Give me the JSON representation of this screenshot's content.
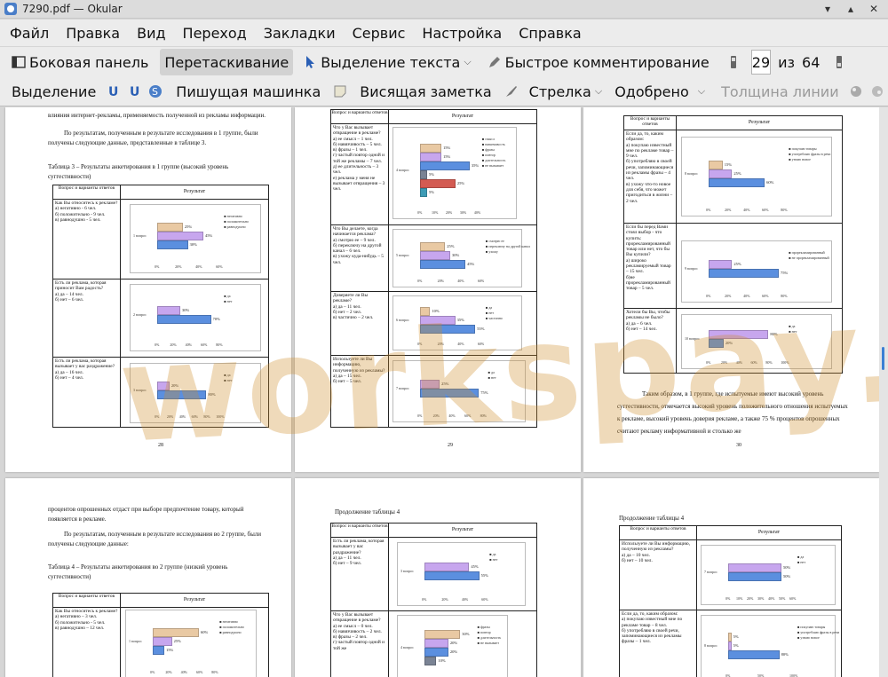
{
  "window": {
    "title": "7290.pdf — Okular"
  },
  "menu": [
    "Файл",
    "Правка",
    "Вид",
    "Переход",
    "Закладки",
    "Сервис",
    "Настройка",
    "Справка"
  ],
  "toolbar": {
    "sidebar": "Боковая панель",
    "drag": "Перетаскивание",
    "text_select": "Выделение текста",
    "quick_comment": "Быстрое комментирование",
    "page_current": "29",
    "page_of": "из",
    "page_total": "64"
  },
  "annot_toolbar": {
    "highlight": "Выделение",
    "typewriter": "Пишущая машинка",
    "note": "Висящая заметка",
    "arrow": "Стрелка",
    "stamp": "Одобрено",
    "line_width": "Толщина линии"
  },
  "watermark": "workspay.ru",
  "pages": {
    "p28": {
      "intro1": "влияния интернет-рекламы, применяемость полученной из рекламы информации.",
      "intro2": "По результатам, полученным в результате исследования в 1 группе, были получены следующие данные, представленные в таблице 3.",
      "caption": "Таблица 3 – Результаты анкетирования в 1 группе (высокий уровень суггестивности)",
      "col1": "Вопрос и варианты ответов",
      "col2": "Результат",
      "q1": "Как Вы относитесь к рекламе?\nа) негативно - 6 чел.\nб) положительно - 9 чел.\nв) равнодушно - 5 чел.",
      "q2": "Есть ли реклама, которая приносит Вам радость?\nа) да – 14 чел.\nб) нет – 6 чел.",
      "q3": "Есть ли реклама, которая вызывает у вас раздражение?\nа) да – 16 чел.\nб) нет – 4 чел.",
      "page_no": "28"
    },
    "p29": {
      "col1": "Вопрос и варианты ответов",
      "col2": "Результат",
      "q4": "Что у Вас вызывает отвращение в рекламе?\nа) ее смысл – 1 чел.\nб) навязчивость – 5 чел.\nв) фразы – 1 чел.\nг) частый повтор одной и той же рекламы – 7 чел.\nд) ее длительность – 3 чел.\nе) реклама у меня не вызывает отвращения – 3 чел.",
      "q5": "Что Вы делаете, когда начинается реклама?\nа) смотрю ее – 9 чел.\nб) переключу на другой канал – 6 чел.\nв) ухожу куда-нибудь – 5 чел.",
      "q6": "Доверяете ли Вы рекламе?\nа) да – 11 чел.\nб) нет – 2 чел.\nв) частично – 2 чел.",
      "q7": "Используете ли Вы информацию, полученную из рекламы?\nа) да – 15 чел.\nб) нет – 5 чел.",
      "page_no": "29"
    },
    "p30": {
      "col1": "Вопрос и варианты ответов",
      "col2": "Результат",
      "q8": "Если да, то, каким образом:\nа) покупаю известный мне по рекламе товар – 9 чел.\nб) употребляю в своей речи, запоминающиеся из рекламы фразы – 4 чел.\nв) ухожу что-то новое для себя, что может пригодиться в жизни – 2 чел.",
      "q9": "Если бы перед Вами стоял выбор - что купить: прорекламированный товар или нет, что бы Вы купили?\nа) широко рекламируемый товар – 15 чел.\nб)не прорекламированный товар – 5 чел.",
      "q10": "Хотели бы Вы, чтобы рекламы не было?\nа) да – 6 чел.\nб) нет – 14 чел.",
      "text": "Таким образом, в 1 группе, где испытуемые имеют высокий уровень суггестивности, отмечается высокий уровень положительного отношения испытуемых к рекламе, высокий уровень доверия рекламе, а также 75 % процентов опрошенных считают рекламу информативной и столько же",
      "page_no": "30"
    },
    "p31": {
      "text1": "процентов опрошенных отдаст при выборе предпочтение товару, который появляется в рекламе.",
      "text2": "По результатам, полученным в результате исследования во 2 группе, были получены следующие данные:",
      "caption": "Таблица 4 – Результаты анкетирования во 2 группе (низкий уровень суггестивности)",
      "col1": "Вопрос и варианты ответов",
      "col2": "Результат",
      "q1": "Как Вы относитесь к рекламе?\nа) негативно – 3 чел.\nб) положительно - 5 чел.\nв) равнодушно – 12 чел."
    },
    "p32": {
      "caption": "Продолжение таблицы 4",
      "col1": "Вопрос и варианты ответов",
      "col2": "Результат",
      "q3": "Есть ли реклама, которая вызывает у вас раздражение?\nа) да – 11 чел.\nб) нет – 9 чел.",
      "q4": "Что у Вас вызывает отвращение в рекламе?\nа) ее смысл – 0 чел.\nб) навязчивость – 2 чел.\nв) фразы – 2 чел.\nг) частый повтор одной и той же"
    },
    "p33": {
      "caption": "Продолжение таблицы 4",
      "col1": "Вопрос и варианты ответов",
      "col2": "Результат",
      "q7": "Используете ли Вы информацию, полученную из рекламы?\nа) да – 10 чел.\nб) нет – 10 чел.",
      "q8": "Если да, то, каким образом:\nа) покупаю известный мне по рекламе товар – 8 чел.\nб) употребляю в своей речи, запоминающиеся из рекламы фразы – 1 чел."
    }
  },
  "chart_data": [
    {
      "type": "bar",
      "label": "1 вопрос",
      "categories": [
        "равнодушно",
        "положительно",
        "негативно"
      ],
      "values": [
        25,
        45,
        30
      ],
      "xticks": [
        "0%",
        "20%",
        "40%",
        "60%"
      ]
    },
    {
      "type": "bar",
      "label": "2 вопрос",
      "categories": [
        "нет",
        "да"
      ],
      "values": [
        30,
        70
      ],
      "xticks": [
        "0%",
        "20%",
        "40%",
        "60%",
        "80%"
      ]
    },
    {
      "type": "bar",
      "label": "3 вопрос",
      "categories": [
        "нет",
        "да"
      ],
      "values": [
        20,
        80
      ],
      "xticks": [
        "0%",
        "20%",
        "40%",
        "60%",
        "80%",
        "100%"
      ]
    },
    {
      "type": "bar",
      "label": "4 вопрос",
      "categories": [
        "не вызывает",
        "длительность",
        "повтор",
        "фразы",
        "навязчивость",
        "смысл"
      ],
      "values": [
        15,
        15,
        35,
        5,
        25,
        5
      ],
      "xticks": [
        "0%",
        "10%",
        "20%",
        "30%",
        "40%"
      ]
    },
    {
      "type": "bar",
      "label": "5 вопрос",
      "categories": [
        "ухожу",
        "переключу на другой канал",
        "смотрю ее"
      ],
      "values": [
        25,
        30,
        45
      ],
      "xticks": [
        "0%",
        "20%",
        "40%",
        "60%"
      ]
    },
    {
      "type": "bar",
      "label": "6 вопрос",
      "categories": [
        "частично",
        "нет",
        "да"
      ],
      "values": [
        10,
        35,
        55
      ],
      "xticks": [
        "0%",
        "20%",
        "40%",
        "60%"
      ]
    },
    {
      "type": "bar",
      "label": "7 вопрос",
      "categories": [
        "нет",
        "да"
      ],
      "values": [
        25,
        75
      ],
      "xticks": [
        "0%",
        "20%",
        "40%",
        "60%",
        "80%"
      ]
    },
    {
      "type": "bar",
      "label": "8 вопрос",
      "categories": [
        "узнаю новое",
        "употребляю фразы в речи",
        "покупаю товары"
      ],
      "values": [
        15,
        25,
        60
      ],
      "xticks": [
        "0%",
        "20%",
        "40%",
        "60%",
        "80%"
      ]
    },
    {
      "type": "bar",
      "label": "9 вопрос",
      "categories": [
        "не прорекламированный",
        "прорекламированный"
      ],
      "values": [
        25,
        75
      ],
      "xticks": [
        "0%",
        "20%",
        "40%",
        "60%",
        "80%"
      ]
    },
    {
      "type": "bar",
      "label": "10 вопрос",
      "categories": [
        "нет",
        "да"
      ],
      "values": [
        80,
        20
      ],
      "xticks": [
        "0%",
        "20%",
        "40%",
        "60%",
        "80%",
        "100%"
      ]
    },
    {
      "type": "bar",
      "label": "1 вопрос",
      "categories": [
        "равнодушно",
        "положительно",
        "негативно"
      ],
      "values": [
        60,
        25,
        15
      ],
      "xticks": [
        "0%",
        "20%",
        "40%",
        "60%",
        "80%"
      ]
    },
    {
      "type": "bar",
      "label": "3 вопрос",
      "categories": [
        "нет",
        "да"
      ],
      "values": [
        45,
        55
      ],
      "xticks": [
        "0%",
        "20%",
        "40%",
        "60%"
      ]
    },
    {
      "type": "bar",
      "label": "4 вопрос",
      "categories": [
        "не вызывает",
        "длительность",
        "повтор",
        "фразы"
      ],
      "values": [
        30,
        20,
        20,
        10
      ],
      "xticks": [
        "0%",
        "10%",
        "20%",
        "30%",
        "40%"
      ]
    },
    {
      "type": "bar",
      "label": "7 вопрос",
      "categories": [
        "нет",
        "да"
      ],
      "values": [
        50,
        50
      ],
      "xticks": [
        "0%",
        "10%",
        "20%",
        "30%",
        "40%",
        "50%",
        "60%"
      ]
    },
    {
      "type": "bar",
      "label": "8 вопрос",
      "categories": [
        "узнаю новое",
        "употребляю фразы в речи",
        "покупаю товары"
      ],
      "values": [
        5,
        5,
        80
      ],
      "xticks": [
        "0%",
        "50%",
        "100%"
      ]
    }
  ]
}
